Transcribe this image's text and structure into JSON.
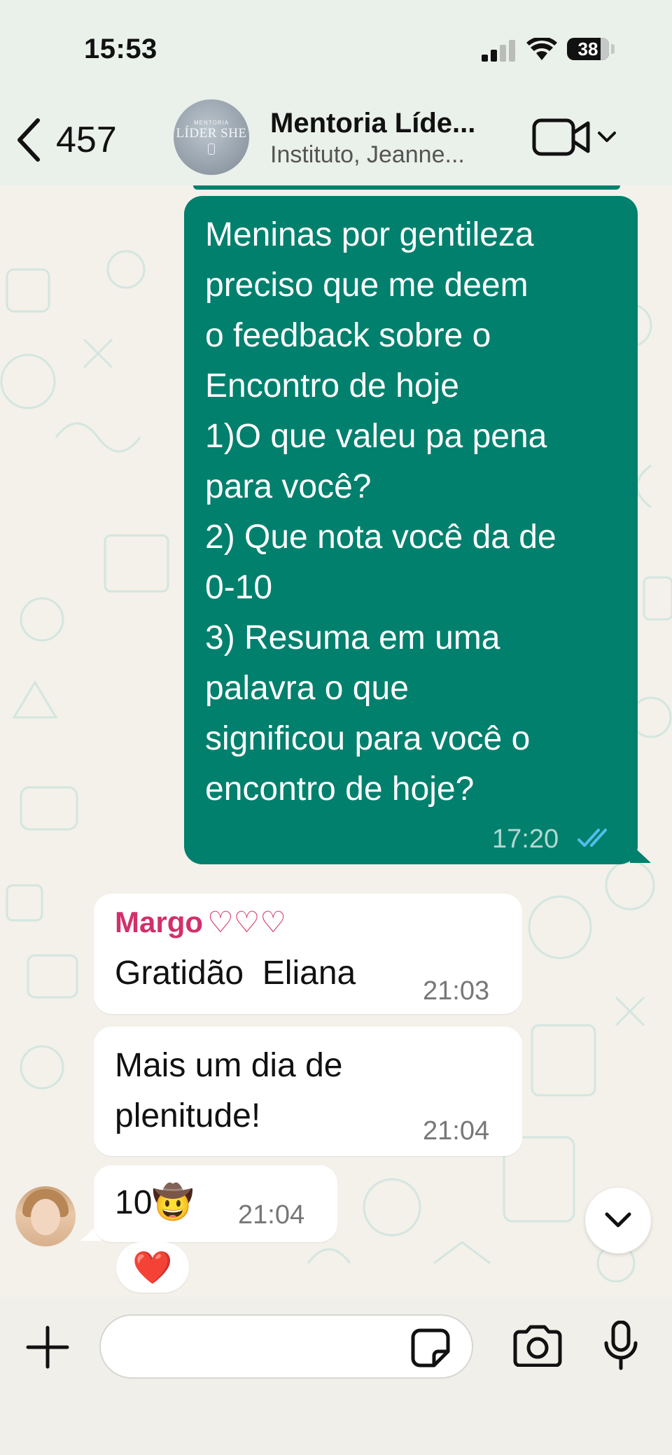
{
  "status_bar": {
    "time": "15:53",
    "battery": "38"
  },
  "header": {
    "back_count": "457",
    "avatar_small": "MENTORIA",
    "avatar_big": "LÍDER SHE",
    "title": "Mentoria Líde...",
    "subtitle": "Instituto, Jeanne..."
  },
  "messages": {
    "outgoing": {
      "text": "Meninas por gentileza\npreciso que me deem\no feedback sobre o\nEncontro de hoje\n1)O que valeu pa pena\npara você?\n2) Que nota você da de\n0-10\n3) Resuma em uma\npalavra o que\nsignificou para você o\nencontro de hoje?",
      "time": "17:20"
    },
    "incoming": [
      {
        "sender": "Margo",
        "hearts": "♡♡♡",
        "text": "Gratidão  Eliana",
        "time": "21:03"
      },
      {
        "text": "Mais um dia de\nplenitude!",
        "time": "21:04"
      },
      {
        "text": "10🤠",
        "time": "21:04",
        "reaction": "❤️"
      }
    ]
  },
  "input": {
    "placeholder": ""
  },
  "colors": {
    "outgoing_bubble": "#00806d",
    "sender_name": "#d1306b",
    "read_ticks": "#53bdeb"
  }
}
